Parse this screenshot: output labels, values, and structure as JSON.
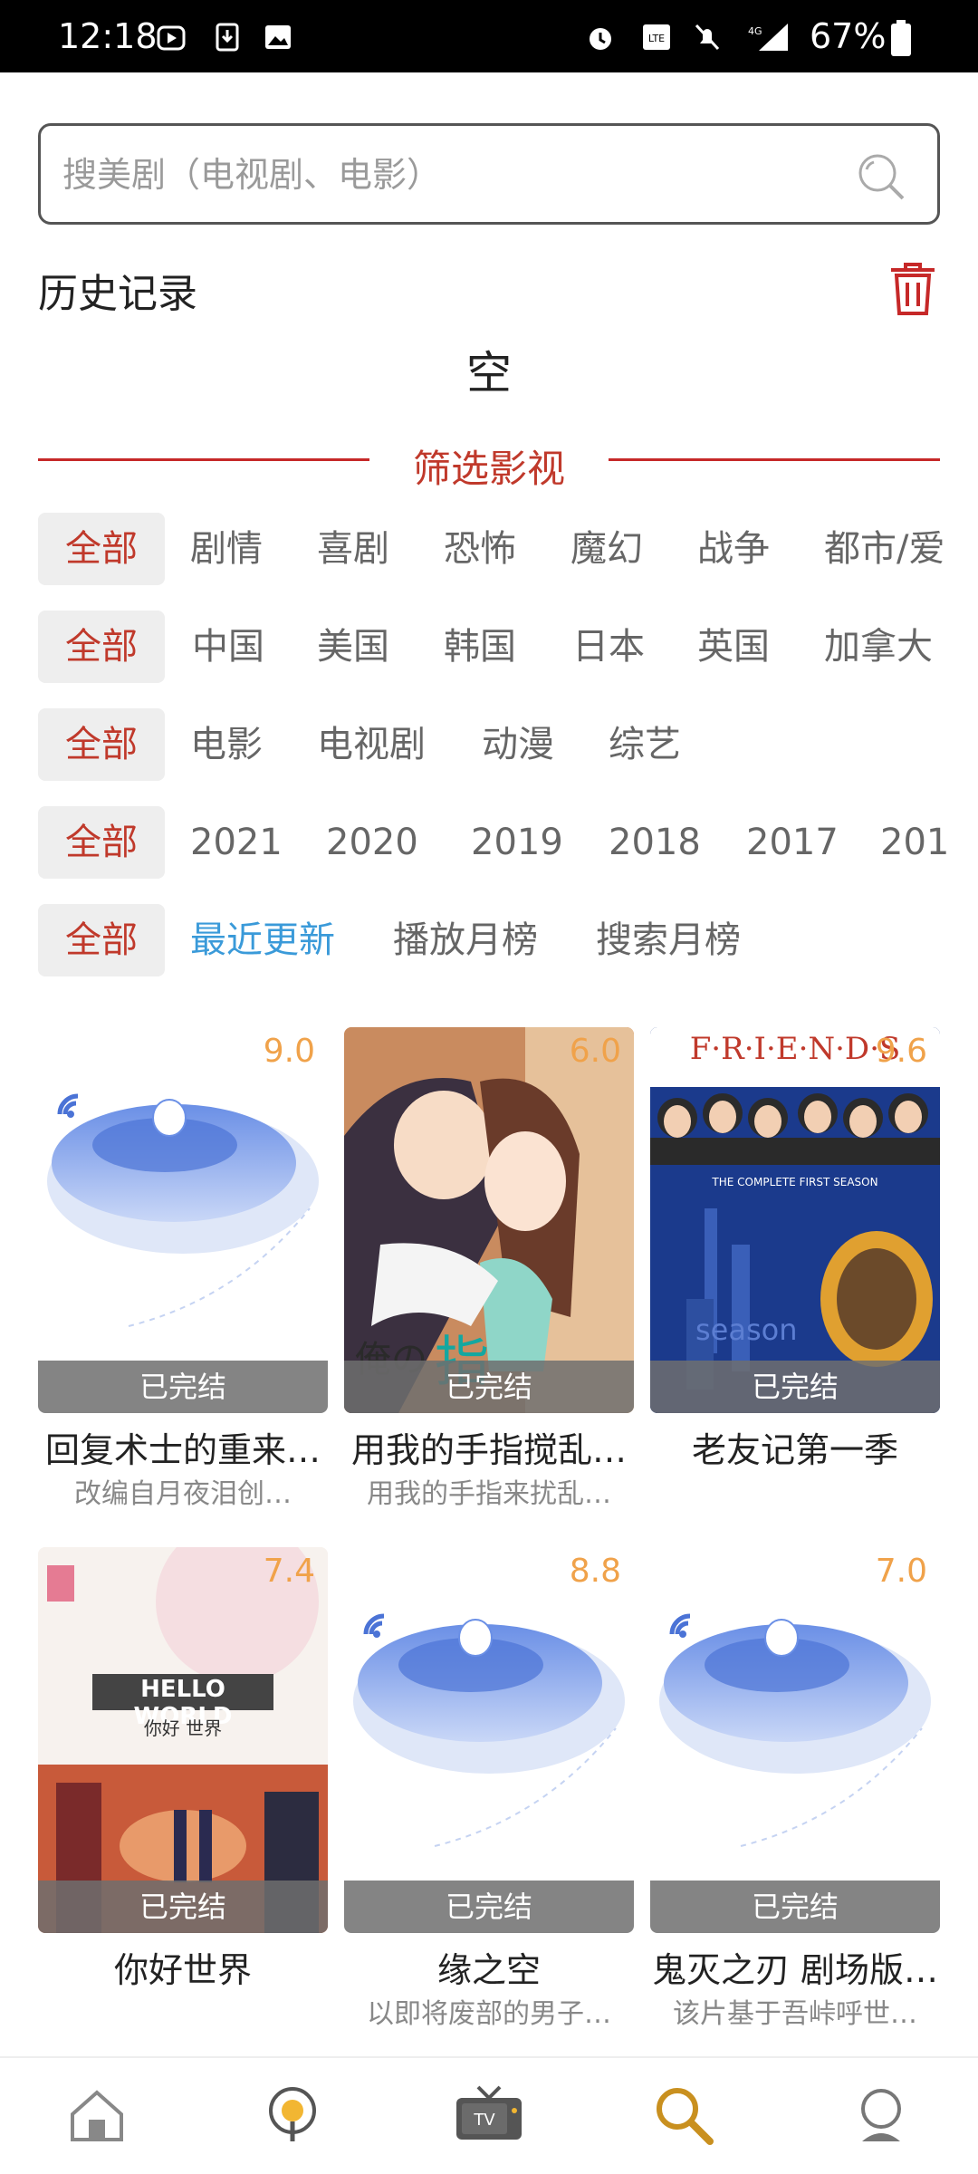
{
  "status_bar": {
    "time": "12:18",
    "battery": "67%"
  },
  "search": {
    "placeholder": "搜美剧（电视剧、电影）"
  },
  "history": {
    "title": "历史记录",
    "empty_text": "空"
  },
  "filter": {
    "title": "筛选影视",
    "rows": [
      [
        "全部",
        "剧情",
        "喜剧",
        "恐怖",
        "魔幻",
        "战争",
        "都市/爱"
      ],
      [
        "全部",
        "中国",
        "美国",
        "韩国",
        "日本",
        "英国",
        "加拿大"
      ],
      [
        "全部",
        "电影",
        "电视剧",
        "动漫",
        "综艺"
      ],
      [
        "全部",
        "2021",
        "2020",
        "2019",
        "2018",
        "2017",
        "201"
      ],
      [
        "全部",
        "最近更新",
        "播放月榜",
        "搜索月榜"
      ]
    ]
  },
  "cards": [
    {
      "title": "回复术士的重来…",
      "subtitle": "改编自月夜泪创…",
      "score": "9.0",
      "status": "已完结",
      "poster": "placeholder-ufo"
    },
    {
      "title": "用我的手指搅乱…",
      "subtitle": "用我的手指来扰乱…",
      "score": "6.0",
      "status": "已完结",
      "poster": "anime-couple"
    },
    {
      "title": "老友记第一季",
      "subtitle": "",
      "score": "9.6",
      "status": "已完结",
      "poster": "friends"
    },
    {
      "title": "你好世界",
      "subtitle": "",
      "score": "7.4",
      "status": "已完结",
      "poster": "hello-world"
    },
    {
      "title": "缘之空",
      "subtitle": "以即将废部的男子…",
      "score": "8.8",
      "status": "已完结",
      "poster": "placeholder-ufo"
    },
    {
      "title": "鬼灭之刃 剧场版…",
      "subtitle": "该片基于吾峠呼世…",
      "score": "7.0",
      "status": "已完结",
      "poster": "placeholder-ufo"
    }
  ],
  "poster_text": {
    "friends_logo": "F·R·I·E·N·D·S",
    "friends_season": "THE COMPLETE FIRST SEASON",
    "hello_world_title": "HELLO WORLD",
    "hello_world_cn": "你好 世界"
  },
  "bottom_nav": [
    "home-icon",
    "podcast-icon",
    "tv-icon",
    "search-icon",
    "profile-icon"
  ],
  "colors": {
    "accent_red": "#c0392b",
    "blue": "#3a9ad9",
    "score": "#f0a24a"
  }
}
